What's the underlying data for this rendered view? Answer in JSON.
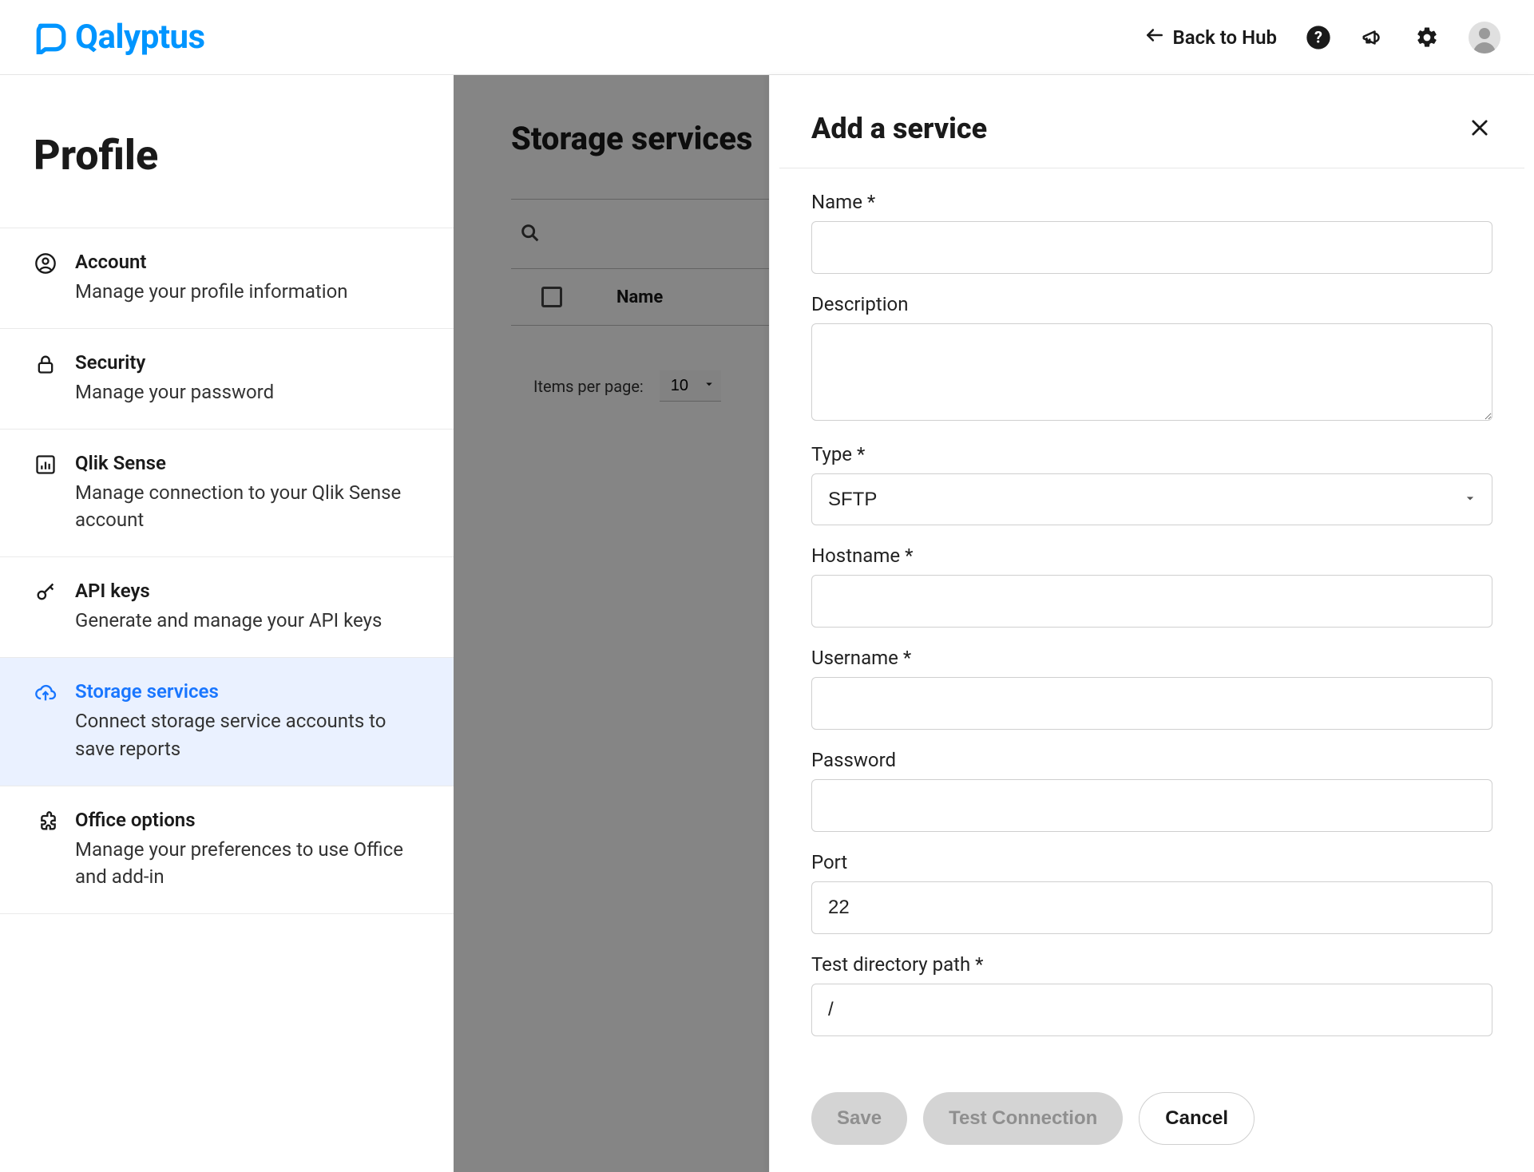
{
  "header": {
    "brand": "Qalyptus",
    "back_label": "Back to Hub"
  },
  "sidebar": {
    "title": "Profile",
    "items": [
      {
        "title": "Account",
        "desc": "Manage your profile information"
      },
      {
        "title": "Security",
        "desc": "Manage your password"
      },
      {
        "title": "Qlik Sense",
        "desc": "Manage connection to your Qlik Sense account"
      },
      {
        "title": "API keys",
        "desc": "Generate and manage your API keys"
      },
      {
        "title": "Storage services",
        "desc": "Connect storage service accounts to save reports"
      },
      {
        "title": "Office options",
        "desc": "Manage your preferences to use Office and add-in"
      }
    ]
  },
  "main": {
    "title": "Storage services",
    "col_name": "Name",
    "pager_label": "Items per page:",
    "pager_value": "10"
  },
  "drawer": {
    "title": "Add a service",
    "fields": {
      "name_label": "Name *",
      "name_value": "",
      "desc_label": "Description",
      "desc_value": "",
      "type_label": "Type *",
      "type_value": "SFTP",
      "host_label": "Hostname *",
      "host_value": "",
      "user_label": "Username *",
      "user_value": "",
      "pass_label": "Password",
      "pass_value": "",
      "port_label": "Port",
      "port_value": "22",
      "path_label": "Test directory path *",
      "path_value": "/"
    },
    "buttons": {
      "save": "Save",
      "test": "Test Connection",
      "cancel": "Cancel"
    }
  }
}
